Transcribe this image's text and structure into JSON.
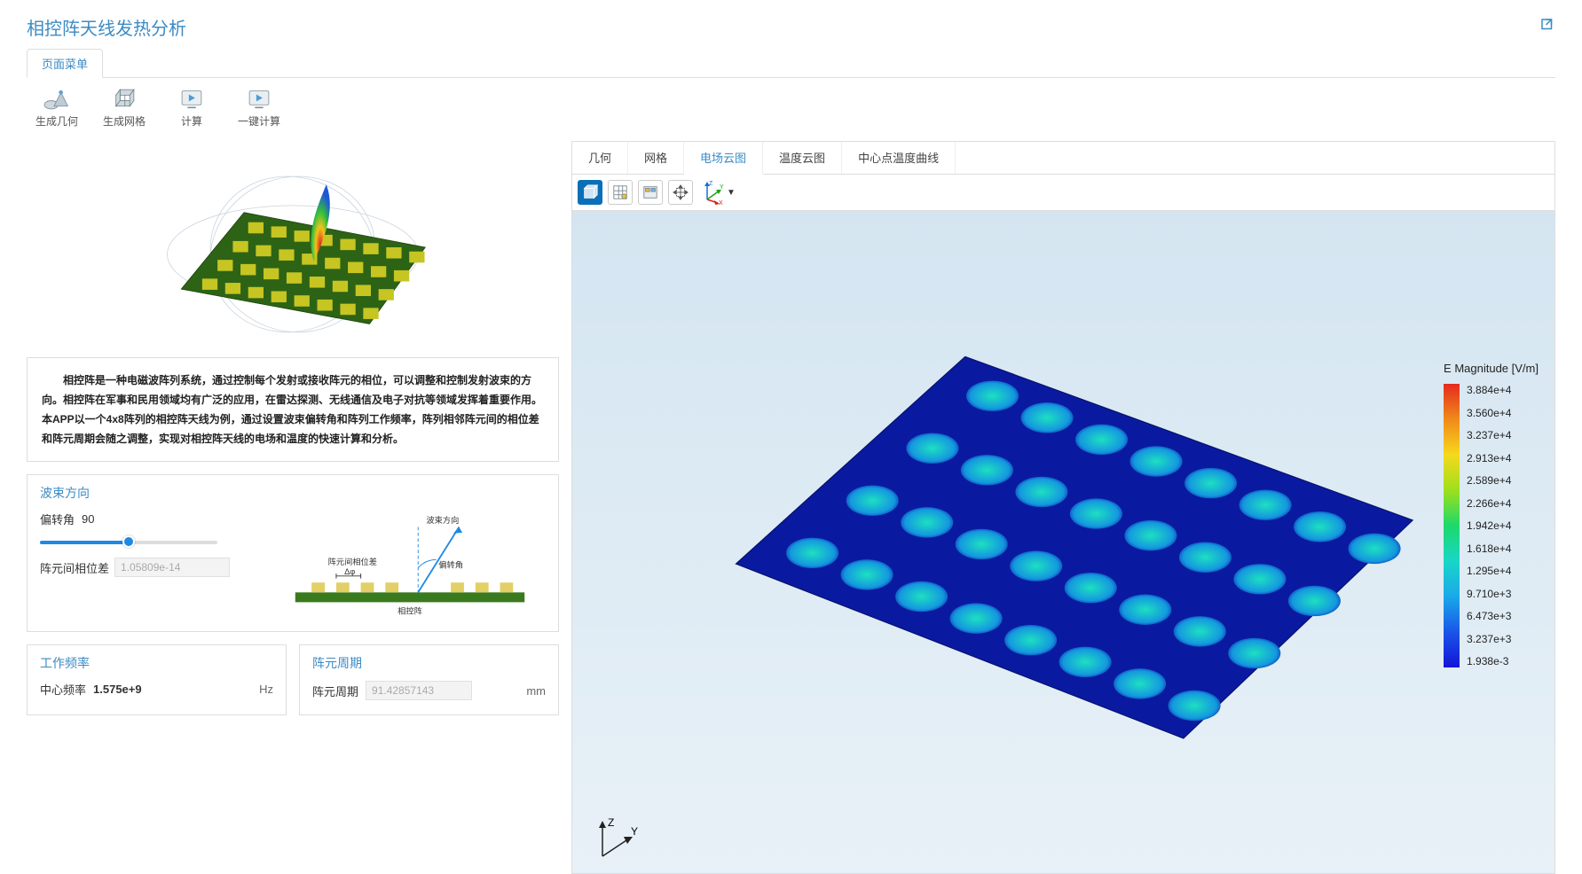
{
  "title": "相控阵天线发热分析",
  "menu_tab": "页面菜单",
  "toolbar": {
    "geom": "生成几何",
    "mesh": "生成网格",
    "compute": "计算",
    "onekey": "一键计算"
  },
  "description": "相控阵是一种电磁波阵列系统，通过控制每个发射或接收阵元的相位，可以调整和控制发射波束的方向。相控阵在军事和民用领域均有广泛的应用，在雷达探测、无线通信及电子对抗等领域发挥着重要作用。本APP以一个4x8阵列的相控阵天线为例，通过设置波束偏转角和阵列工作频率，阵列相邻阵元间的相位差和阵元周期会随之调整，实现对相控阵天线的电场和温度的快速计算和分析。",
  "beam": {
    "section_title": "波束方向",
    "angle_label": "偏转角",
    "angle_value": "90",
    "slider_pct": 50,
    "phase_label": "阵元间相位差",
    "phase_value": "1.05809e-14",
    "diagram": {
      "phase_label": "阵元间相位差",
      "phase_symbol": "Δφ",
      "beam_label": "波束方向",
      "angle_label": "偏转角",
      "array_label": "相控阵"
    }
  },
  "freq": {
    "section_title": "工作频率",
    "center_label": "中心频率",
    "center_value": "1.575e+9",
    "center_unit": "Hz"
  },
  "period": {
    "section_title": "阵元周期",
    "label": "阵元周期",
    "value": "91.42857143",
    "unit": "mm"
  },
  "rtabs": {
    "geom": "几何",
    "mesh": "网格",
    "efield": "电场云图",
    "temp": "温度云图",
    "curve": "中心点温度曲线"
  },
  "triad": {
    "z": "Z",
    "y": "Y",
    "x": "X"
  },
  "legend": {
    "title": "E Magnitude [V/m]",
    "ticks": [
      "3.884e+4",
      "3.560e+4",
      "3.237e+4",
      "2.913e+4",
      "2.589e+4",
      "2.266e+4",
      "1.942e+4",
      "1.618e+4",
      "1.295e+4",
      "9.710e+3",
      "6.473e+3",
      "3.237e+3",
      "1.938e-3"
    ]
  },
  "axis_corner": {
    "z": "Z",
    "y": "Y"
  }
}
